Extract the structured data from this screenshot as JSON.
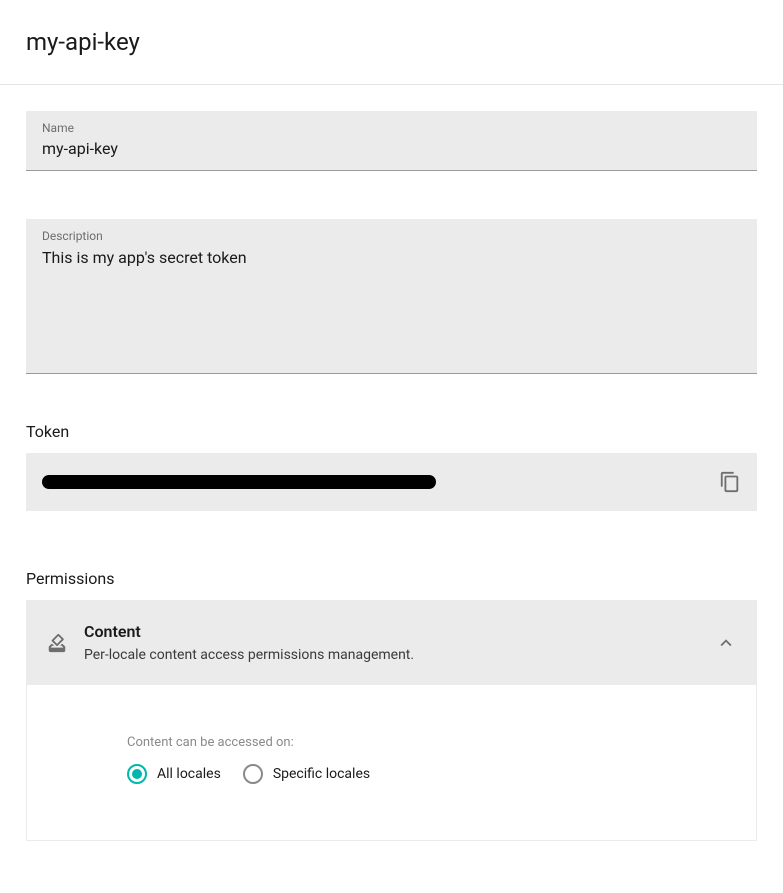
{
  "header": {
    "title": "my-api-key"
  },
  "fields": {
    "name": {
      "label": "Name",
      "value": "my-api-key"
    },
    "description": {
      "label": "Description",
      "value": "This is my app's secret token"
    }
  },
  "token": {
    "label": "Token"
  },
  "permissions": {
    "label": "Permissions",
    "content": {
      "title": "Content",
      "subtitle": "Per-locale content access permissions management.",
      "access_label": "Content can be accessed on:",
      "options": {
        "all": "All locales",
        "specific": "Specific locales"
      },
      "selected": "all"
    }
  }
}
